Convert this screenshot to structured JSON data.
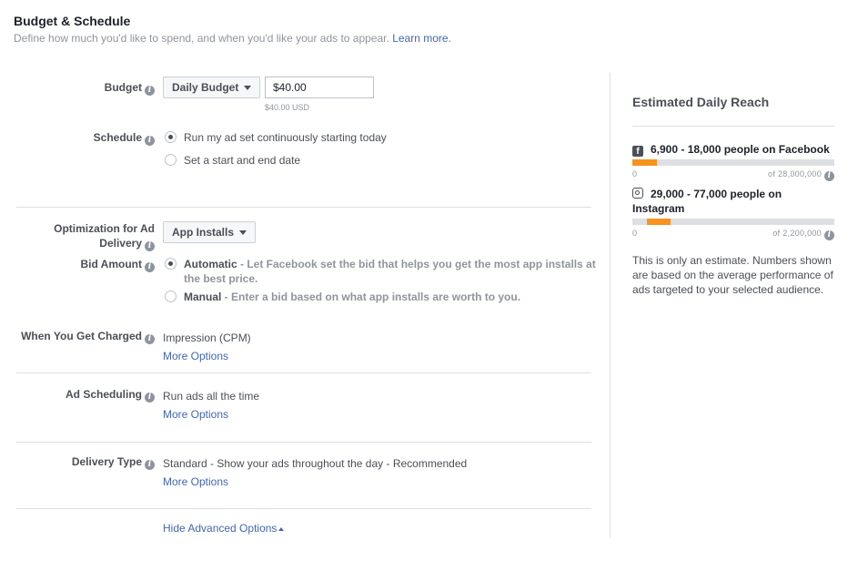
{
  "header": {
    "title": "Budget & Schedule",
    "subtitle": "Define how much you'd like to spend, and when you'd like your ads to appear.",
    "learn_more": "Learn more."
  },
  "budget": {
    "label": "Budget",
    "type_label": "Daily Budget",
    "amount": "$40.00",
    "amount_hint": "$40.00 USD"
  },
  "schedule": {
    "label": "Schedule",
    "options": [
      {
        "label": "Run my ad set continuously starting today",
        "checked": true
      },
      {
        "label": "Set a start and end date",
        "checked": false
      }
    ]
  },
  "optimization": {
    "label_line1": "Optimization for Ad",
    "label_line2": "Delivery",
    "value": "App Installs"
  },
  "bid_amount": {
    "label": "Bid Amount",
    "automatic_title": "Automatic",
    "automatic_desc_line1": " - Let Facebook set the bid that helps you get the most app installs at",
    "automatic_desc_line2": "the best price.",
    "manual_title": "Manual",
    "manual_desc": " - Enter a bid based on what app installs are worth to you."
  },
  "charged": {
    "label": "When You Get Charged",
    "value": "Impression (CPM)",
    "more": "More Options"
  },
  "ad_scheduling": {
    "label": "Ad Scheduling",
    "value": "Run ads all the time",
    "more": "More Options"
  },
  "delivery_type": {
    "label": "Delivery Type",
    "value_bold": "Standard",
    "value_rest": " - Show your ads throughout the day - Recommended",
    "more": "More Options"
  },
  "hide_advanced": "Hide Advanced Options",
  "reach": {
    "title": "Estimated Daily Reach",
    "facebook": {
      "icon": "facebook-icon",
      "text": "6,900 - 18,000 people on Facebook",
      "min": "0",
      "max": "of 28,000,000",
      "range_start": 0.0,
      "range_end": 0.12
    },
    "instagram": {
      "icon": "instagram-icon",
      "text_line1": "29,000 - 77,000 people on",
      "text_line2": "Instagram",
      "min": "0",
      "max": "of 2,200,000",
      "range_start": 0.07,
      "range_end": 0.19
    },
    "note": "This is only an estimate. Numbers shown are based on the average performance of ads targeted to your selected audience."
  },
  "colors": {
    "link": "#4267b2",
    "bar_fill": "#f7931e",
    "bar_track": "#dddfe2"
  }
}
